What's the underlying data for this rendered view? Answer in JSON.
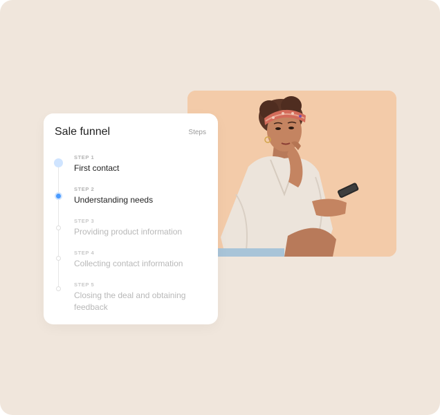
{
  "card": {
    "title": "Sale funnel",
    "meta": "Steps"
  },
  "steps": [
    {
      "label": "STEP 1",
      "text": "First contact",
      "state": "done"
    },
    {
      "label": "STEP 2",
      "text": "Understanding needs",
      "state": "current"
    },
    {
      "label": "STEP 3",
      "text": "Providing product information",
      "state": "pending"
    },
    {
      "label": "STEP 4",
      "text": "Collecting contact information",
      "state": "pending"
    },
    {
      "label": "STEP 5",
      "text": "Closing the deal and obtaining feedback",
      "state": "pending"
    }
  ],
  "colors": {
    "page_bg": "#f0e6dc",
    "photo_bg": "#f3c9a8",
    "accent_blue": "#4a9bff",
    "accent_blue_light": "#cfe4ff"
  }
}
